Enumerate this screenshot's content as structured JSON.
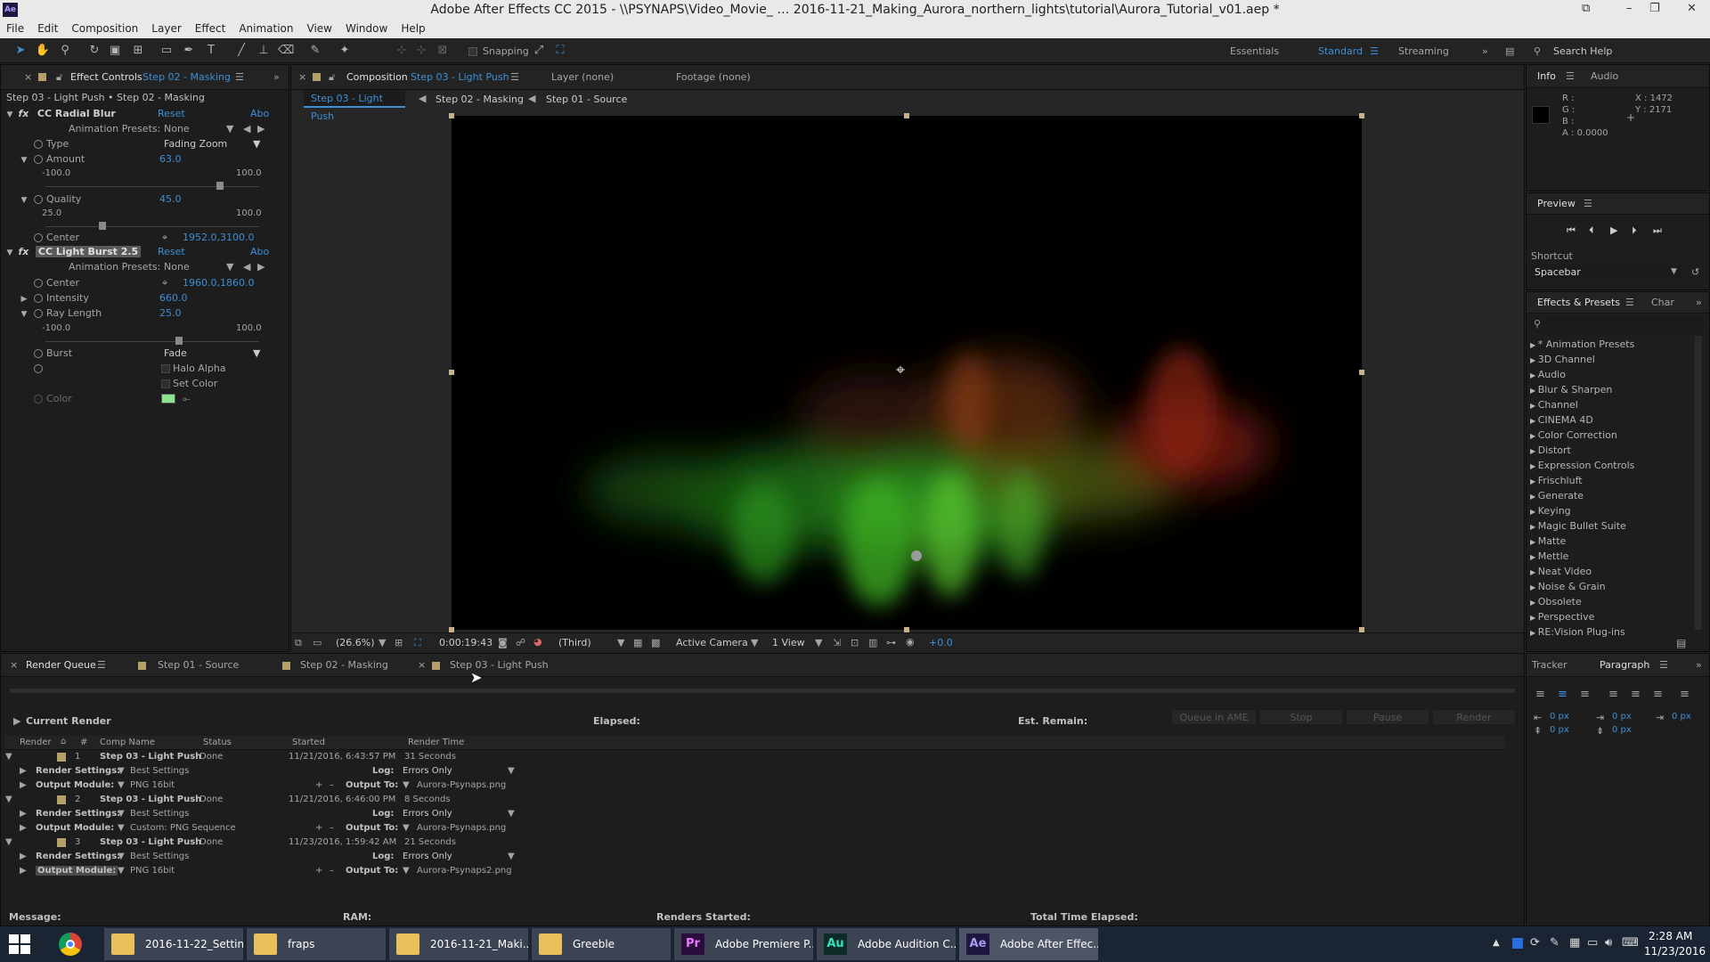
{
  "titlebar": {
    "title": "Adobe After Effects CC 2015 - \\\\PSYNAPS\\Video_Movie_ … 2016-11-21_Making_Aurora_northern_lights\\tutorial\\Aurora_Tutorial_v01.aep *",
    "app_icon": "Ae"
  },
  "menu": [
    "File",
    "Edit",
    "Composition",
    "Layer",
    "Effect",
    "Animation",
    "View",
    "Window",
    "Help"
  ],
  "toolbar": {
    "snapping": "Snapping",
    "workspaces": [
      "Essentials",
      "Standard",
      "Streaming"
    ],
    "search_help": "Search Help"
  },
  "effect_controls": {
    "tab_label": "Effect Controls",
    "tab_layer": "Step 02 - Masking",
    "breadcrumb": "Step 03 - Light Push • Step 02 - Masking",
    "reset": "Reset",
    "about": "Abo",
    "radial": {
      "name": "CC Radial Blur",
      "anim_presets_label": "Animation Presets:",
      "anim_presets_value": "None",
      "type_label": "Type",
      "type_value": "Fading Zoom",
      "amount_label": "Amount",
      "amount_value": "63.0",
      "amount_min": "-100.0",
      "amount_max": "100.0",
      "amount_level": 0.815,
      "quality_label": "Quality",
      "quality_value": "45.0",
      "quality_min": "25.0",
      "quality_max": "100.0",
      "quality_level": 0.267,
      "center_label": "Center",
      "center_value": "1952.0,3100.0"
    },
    "burst": {
      "name": "CC Light Burst 2.5",
      "anim_presets_label": "Animation Presets:",
      "anim_presets_value": "None",
      "center_label": "Center",
      "center_value": "1960.0,1860.0",
      "intensity_label": "Intensity",
      "intensity_value": "660.0",
      "raylength_label": "Ray Length",
      "raylength_value": "25.0",
      "ray_min": "-100.0",
      "ray_max": "100.0",
      "ray_level": 0.625,
      "burst_label": "Burst",
      "burst_value": "Fade",
      "halo_label": "Halo Alpha",
      "setcolor_label": "Set Color",
      "color_label": "Color",
      "color_swatch": "#8fe28f"
    }
  },
  "composition": {
    "tab_label": "Composition",
    "tab_comp": "Step 03 - Light Push",
    "layer_tab": "Layer (none)",
    "footage_tab": "Footage (none)",
    "crumbs": [
      "Step 03 - Light Push",
      "Step 02 - Masking",
      "Step 01 - Source"
    ],
    "footer": {
      "zoom": "(26.6%)",
      "timecode": "0:00:19:43",
      "resolution": "(Third)",
      "camera": "Active Camera",
      "views": "1 View",
      "exposure": "+0.0"
    }
  },
  "info": {
    "tabs": [
      "Info",
      "Audio"
    ],
    "r": "R :",
    "g": "G :",
    "b": "B :",
    "a": "A : 0.0000",
    "x": "X : 1472",
    "y": "Y : 2171"
  },
  "preview": {
    "title": "Preview",
    "shortcut_label": "Shortcut",
    "shortcut_value": "Spacebar"
  },
  "effects_presets": {
    "title": "Effects & Presets",
    "other_tab": "Char",
    "items": [
      "* Animation Presets",
      "3D Channel",
      "Audio",
      "Blur & Sharpen",
      "Channel",
      "CINEMA 4D",
      "Color Correction",
      "Distort",
      "Expression Controls",
      "Frischluft",
      "Generate",
      "Keying",
      "Magic Bullet Suite",
      "Matte",
      "Mettle",
      "Neat Video",
      "Noise & Grain",
      "Obsolete",
      "Perspective",
      "RE:Vision Plug-ins"
    ]
  },
  "render_queue": {
    "tab_label": "Render Queue",
    "other_tabs": [
      "Step 01 - Source",
      "Step 02 - Masking",
      "Step 03 - Light Push"
    ],
    "current_render": "Current Render",
    "elapsed": "Elapsed:",
    "est_remain": "Est. Remain:",
    "buttons": [
      "Queue in AME",
      "Stop",
      "Pause",
      "Render"
    ],
    "columns": [
      "Render",
      "#",
      "Comp Name",
      "Status",
      "Started",
      "Render Time"
    ],
    "labels": {
      "render_settings": "Render Settings:",
      "output_module": "Output Module:",
      "log": "Log:",
      "output_to": "Output To:"
    },
    "items": [
      {
        "num": "1",
        "comp": "Step 03 - Light Push",
        "status": "Done",
        "started": "11/21/2016, 6:43:57 PM",
        "time": "31 Seconds",
        "settings": "Best Settings",
        "log": "Errors Only",
        "module": "PNG 16bit",
        "output": "Aurora-Psynaps.png"
      },
      {
        "num": "2",
        "comp": "Step 03 - Light Push",
        "status": "Done",
        "started": "11/21/2016, 6:46:00 PM",
        "time": "8 Seconds",
        "settings": "Best Settings",
        "log": "Errors Only",
        "module": "Custom: PNG Sequence",
        "output": "Aurora-Psynaps.png"
      },
      {
        "num": "3",
        "comp": "Step 03 - Light Push",
        "status": "Done",
        "started": "11/23/2016, 1:59:42 AM",
        "time": "21 Seconds",
        "settings": "Best Settings",
        "log": "Errors Only",
        "module": "PNG 16bit",
        "output": "Aurora-Psynaps2.png"
      }
    ],
    "footer": {
      "message": "Message:",
      "ram": "RAM:",
      "renders_started": "Renders Started:",
      "total_elapsed": "Total Time Elapsed:"
    }
  },
  "tracker": {
    "tabs": [
      "Tracker",
      "Paragraph"
    ],
    "values": [
      "0 px",
      "0 px",
      "0 px",
      "0 px",
      "0 px"
    ]
  },
  "taskbar": {
    "items": [
      "2016-11-22_Settin...",
      "fraps",
      "2016-11-21_Maki...",
      "Greeble",
      "Adobe Premiere P...",
      "Adobe Audition C...",
      "Adobe After Effec..."
    ],
    "icons": {
      "pr": "Pr",
      "au": "Au",
      "ae": "Ae"
    },
    "time": "2:28 AM",
    "date": "11/23/2016"
  }
}
